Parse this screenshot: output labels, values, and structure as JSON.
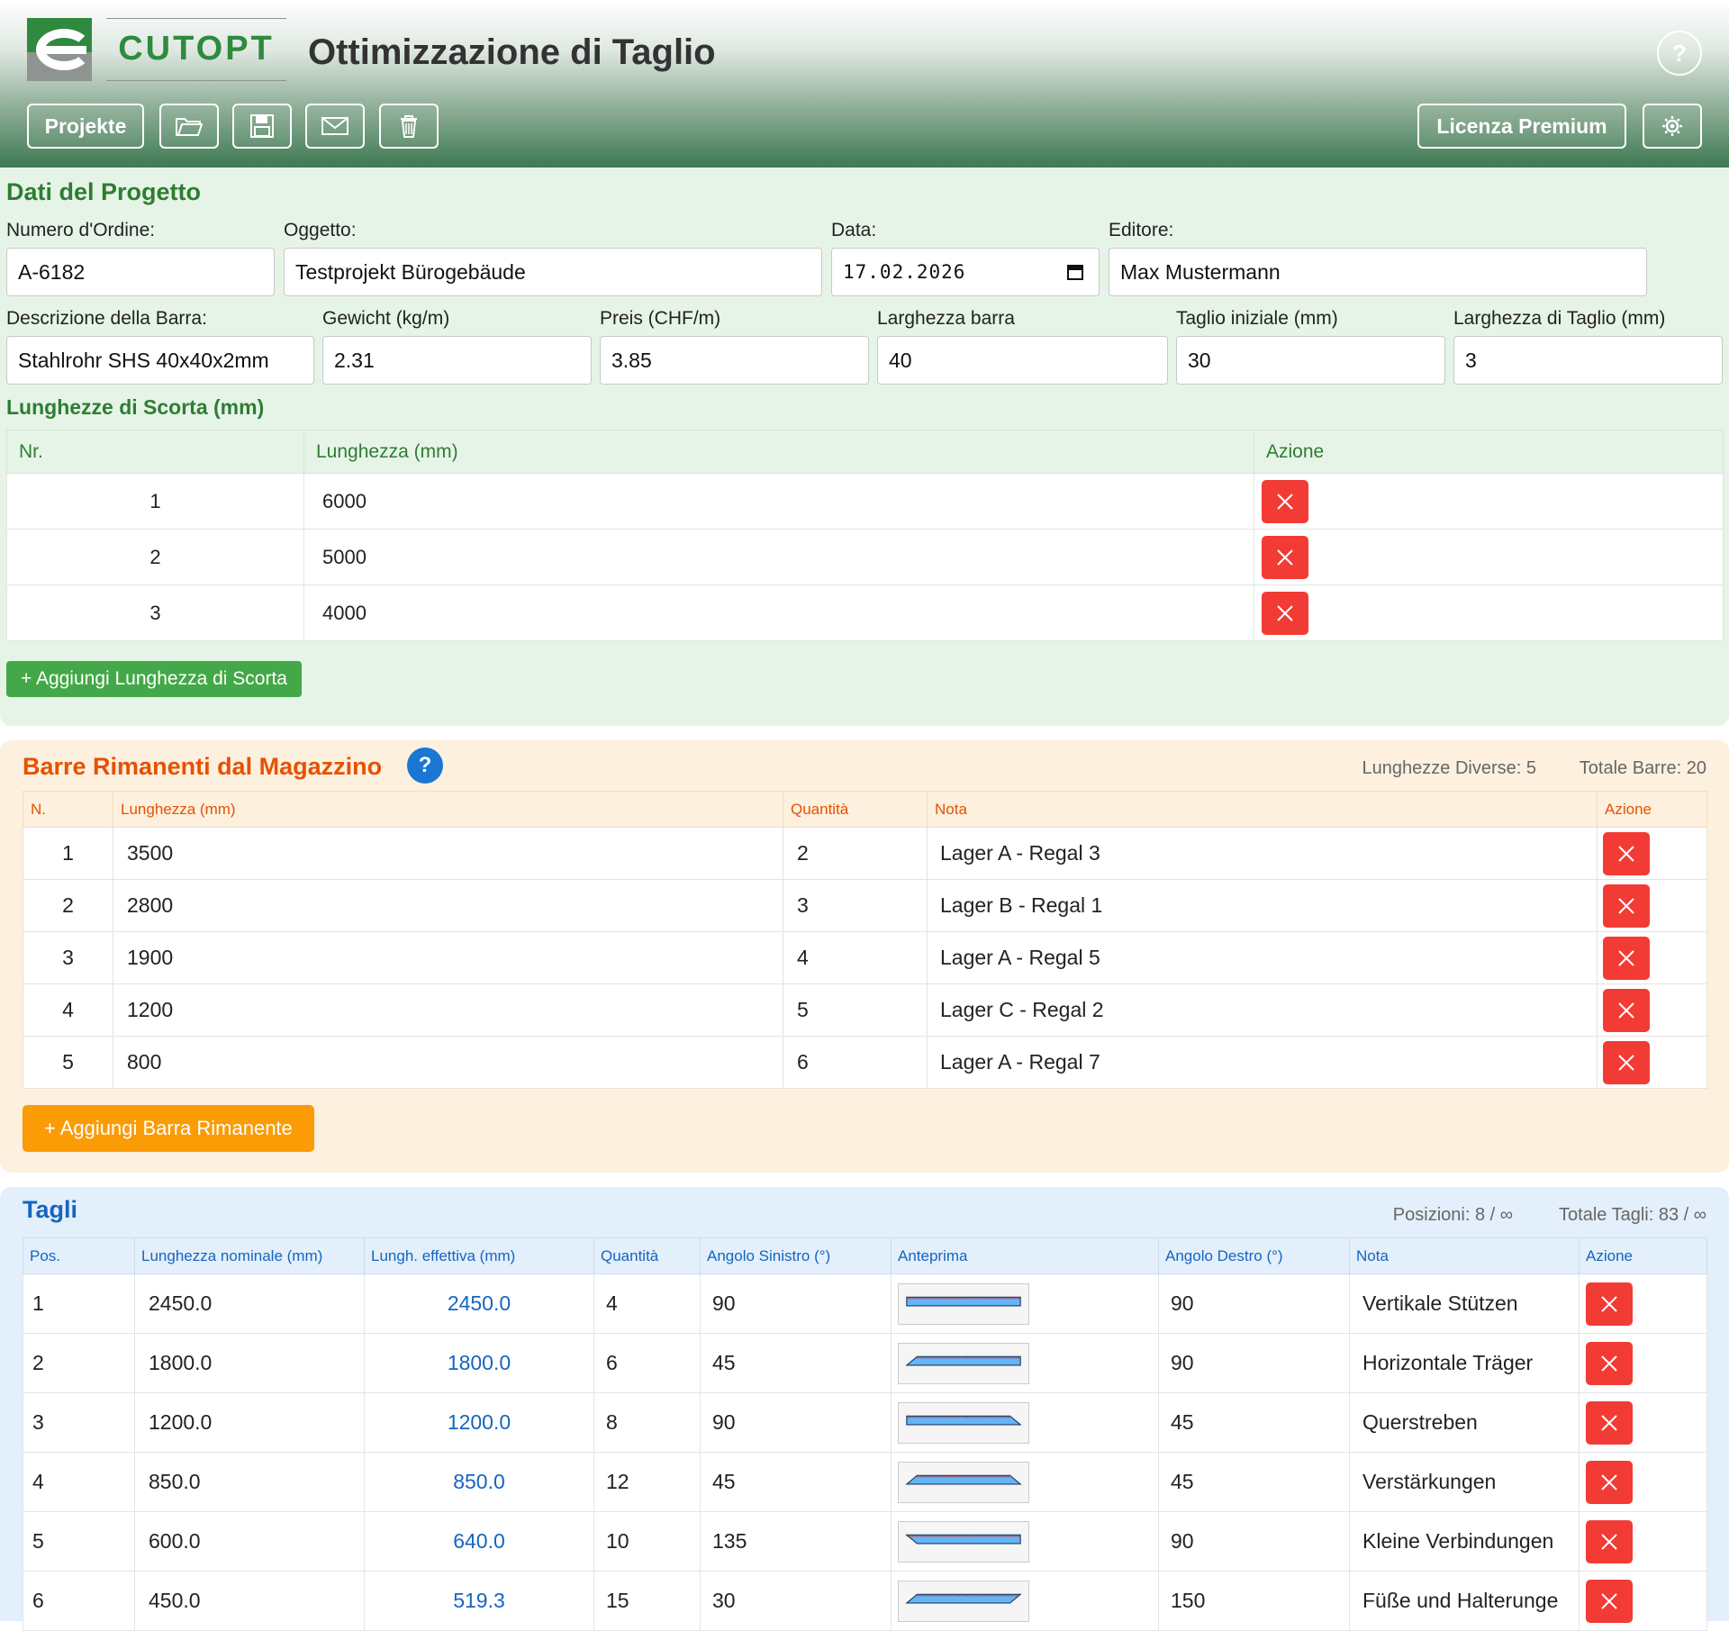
{
  "header": {
    "logo_text": "CUTOPT",
    "title": "Ottimizzazione di Taglio",
    "help_symbol": "?",
    "projects_label": "Projekte",
    "premium_label": "Licenza Premium",
    "icons": [
      "folder-open-icon",
      "save-icon",
      "mail-icon",
      "trash-icon",
      "gear-icon"
    ]
  },
  "project": {
    "section_title": "Dati del Progetto",
    "order_label": "Numero d'Ordine:",
    "order_value": "A-6182",
    "object_label": "Oggetto:",
    "object_value": "Testprojekt Bürogebäude",
    "date_label": "Data:",
    "date_value": "17.02.2026",
    "editor_label": "Editore:",
    "editor_value": "Max Mustermann",
    "bar_desc_label": "Descrizione della Barra:",
    "bar_desc_value": "Stahlrohr SHS 40x40x2mm",
    "weight_label": "Gewicht (kg/m)",
    "weight_value": "2.31",
    "price_label": "Preis (CHF/m)",
    "price_value": "3.85",
    "bar_width_label": "Larghezza barra",
    "bar_width_value": "40",
    "initial_cut_label": "Taglio iniziale (mm)",
    "initial_cut_value": "30",
    "kerf_label": "Larghezza di Taglio (mm)",
    "kerf_value": "3"
  },
  "stock": {
    "title": "Lunghezze di Scorta (mm)",
    "headers": [
      "Nr.",
      "Lunghezza (mm)",
      "Azione"
    ],
    "rows": [
      {
        "nr": "1",
        "length": "6000"
      },
      {
        "nr": "2",
        "length": "5000"
      },
      {
        "nr": "3",
        "length": "4000"
      }
    ],
    "add_label": "+ Aggiungi Lunghezza di Scorta"
  },
  "remnants": {
    "title": "Barre Rimanenti dal Magazzino",
    "help_symbol": "?",
    "stat_lengths": "Lunghezze Diverse: 5",
    "stat_total": "Totale Barre: 20",
    "headers": [
      "N.",
      "Lunghezza (mm)",
      "Quantità",
      "Nota",
      "Azione"
    ],
    "rows": [
      {
        "n": "1",
        "length": "3500",
        "qty": "2",
        "note": "Lager A - Regal 3"
      },
      {
        "n": "2",
        "length": "2800",
        "qty": "3",
        "note": "Lager B - Regal 1"
      },
      {
        "n": "3",
        "length": "1900",
        "qty": "4",
        "note": "Lager A - Regal 5"
      },
      {
        "n": "4",
        "length": "1200",
        "qty": "5",
        "note": "Lager C - Regal 2"
      },
      {
        "n": "5",
        "length": "800",
        "qty": "6",
        "note": "Lager A - Regal 7"
      }
    ],
    "add_label": "+ Aggiungi Barra Rimanente"
  },
  "cuts": {
    "title": "Tagli",
    "stat_positions": "Posizioni: 8 / ∞",
    "stat_total": "Totale Tagli: 83 / ∞",
    "headers": [
      "Pos.",
      "Lunghezza nominale (mm)",
      "Lungh. effettiva (mm)",
      "Quantità",
      "Angolo Sinistro (°)",
      "Anteprima",
      "Angolo Destro (°)",
      "Nota",
      "Azione"
    ],
    "rows": [
      {
        "pos": "1",
        "nominal": "2450.0",
        "effective": "2450.0",
        "qty": "4",
        "left": "90",
        "right": "90",
        "note": "Vertikale Stützen"
      },
      {
        "pos": "2",
        "nominal": "1800.0",
        "effective": "1800.0",
        "qty": "6",
        "left": "45",
        "right": "90",
        "note": "Horizontale Träger"
      },
      {
        "pos": "3",
        "nominal": "1200.0",
        "effective": "1200.0",
        "qty": "8",
        "left": "90",
        "right": "45",
        "note": "Querstreben"
      },
      {
        "pos": "4",
        "nominal": "850.0",
        "effective": "850.0",
        "qty": "12",
        "left": "45",
        "right": "45",
        "note": "Verstärkungen"
      },
      {
        "pos": "5",
        "nominal": "600.0",
        "effective": "640.0",
        "qty": "10",
        "left": "135",
        "right": "90",
        "note": "Kleine Verbindungen"
      },
      {
        "pos": "6",
        "nominal": "450.0",
        "effective": "519.3",
        "qty": "15",
        "left": "30",
        "right": "150",
        "note": "Füße und Halterunge"
      }
    ],
    "preview_color": "#64b5f6",
    "preview_edge_color": "#c62828"
  },
  "colors": {
    "green_accent": "#2e7d32",
    "orange_accent": "#e65100",
    "blue_accent": "#1565c0",
    "delete_red": "#f23b35"
  }
}
